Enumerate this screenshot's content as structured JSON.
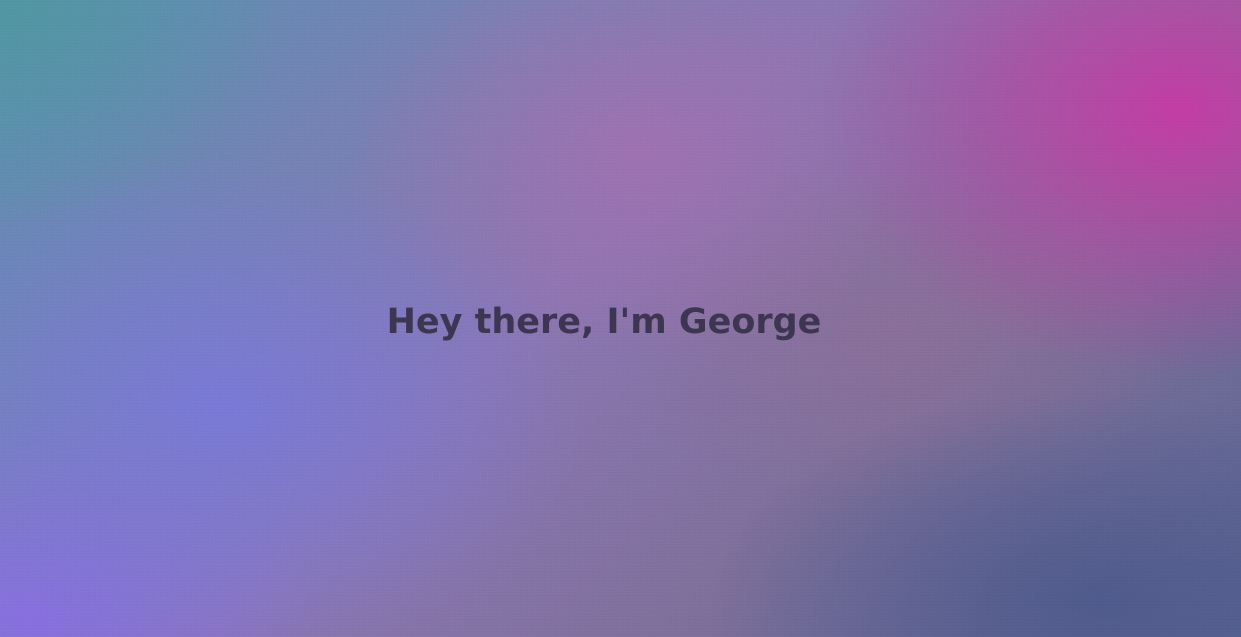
{
  "hero": {
    "headline": "Hey there, I'm George"
  },
  "colors": {
    "headline_text": "#3d3650",
    "gradient_top_left": "#5096a0",
    "gradient_top_right": "#c63aa5",
    "gradient_bottom_left": "#876ee1",
    "gradient_bottom_right": "#4e5a8c"
  }
}
